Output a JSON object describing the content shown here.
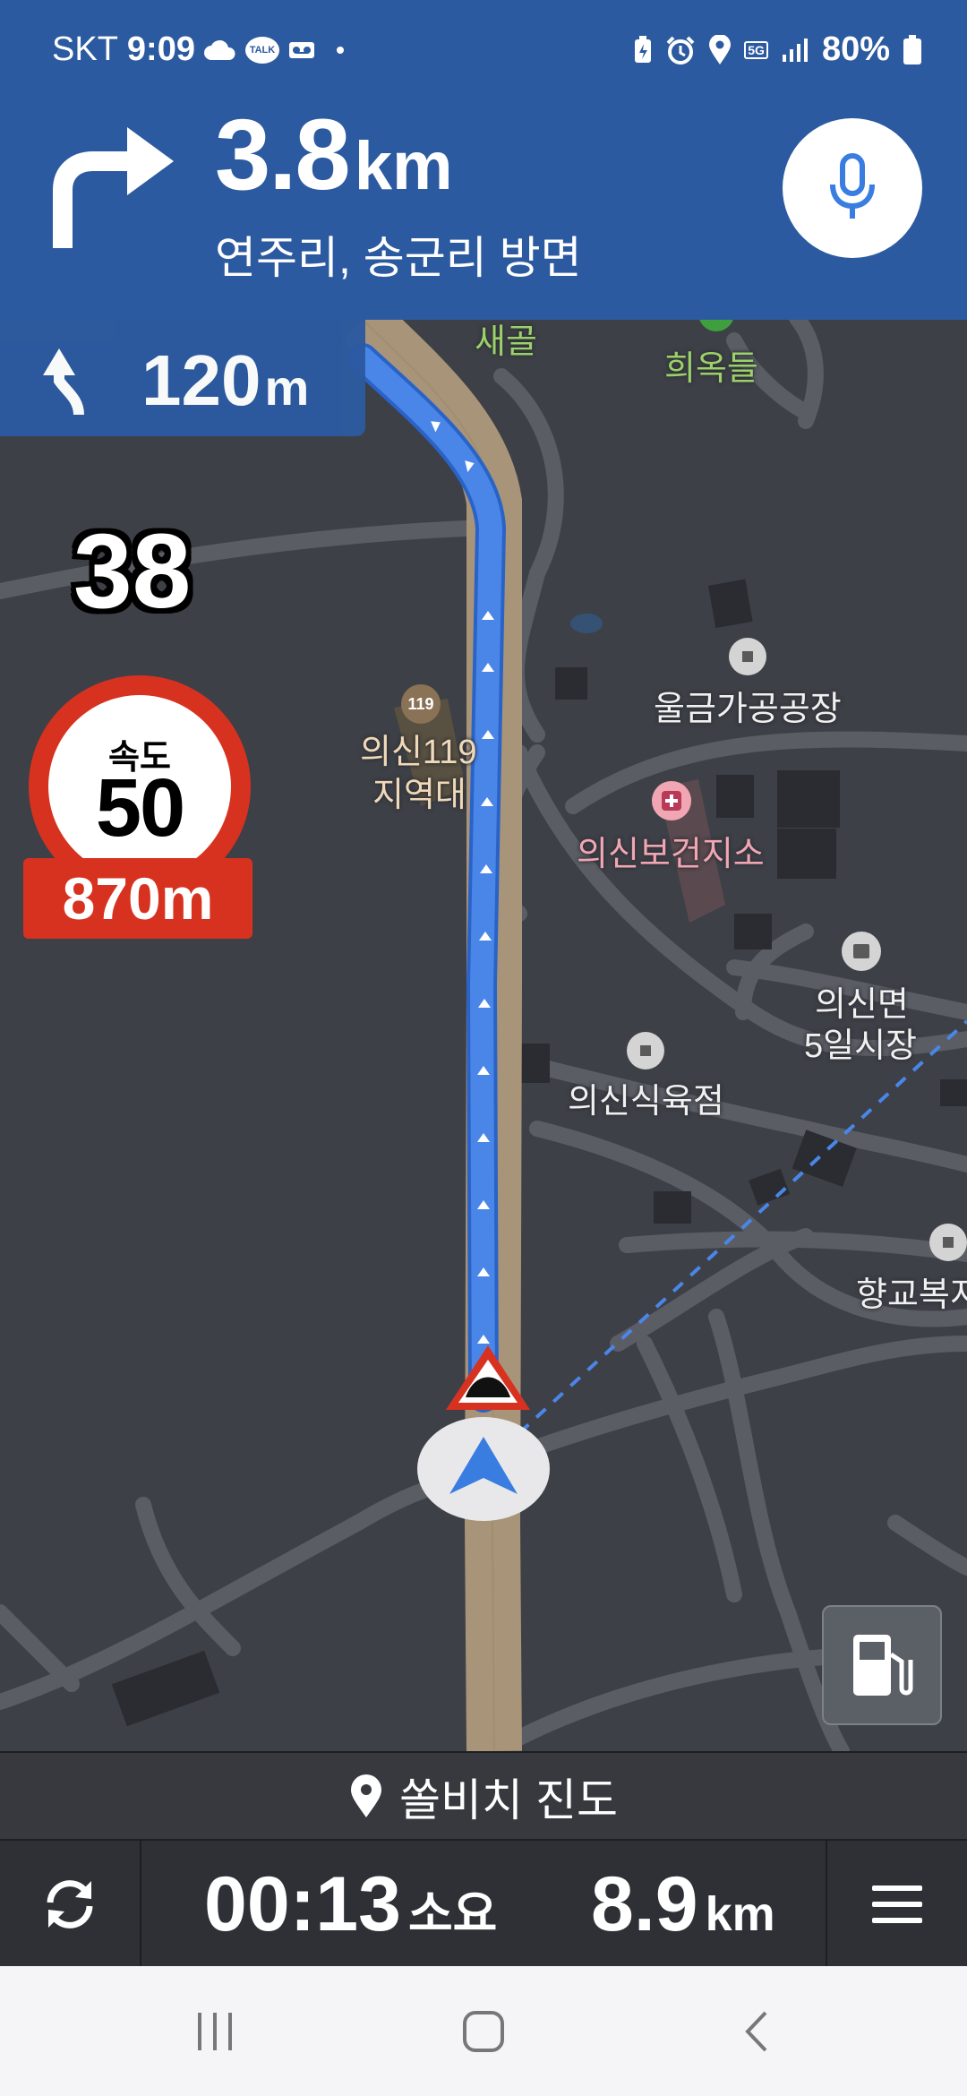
{
  "status_bar": {
    "carrier": "SKT",
    "time": "9:09",
    "network": "5G",
    "battery": "80%",
    "icons": [
      "cloud-icon",
      "kakaotalk-icon",
      "voicemail-icon",
      "dot-icon",
      "battery-saver-icon",
      "alarm-icon",
      "location-icon",
      "signal-icon",
      "battery-icon"
    ]
  },
  "guidance": {
    "distance_value": "3.8",
    "distance_unit": "km",
    "direction_text": "연주리, 송군리 방면",
    "turn_icon": "turn-right-icon",
    "voice_icon": "microphone-icon"
  },
  "next_turn": {
    "distance_value": "120",
    "distance_unit": "m",
    "turn_icon": "turn-left-curve-icon"
  },
  "current_speed": "38",
  "speed_limit": {
    "label": "속도",
    "value": "50",
    "distance": "870m"
  },
  "map_labels": {
    "saegol": "새골",
    "huiokdeul": "희옥들",
    "fire_station_line1": "의신119",
    "fire_station_line2": "지역대",
    "factory": "울금가공공장",
    "health_center": "의신보건지소",
    "market_line1": "의신면",
    "market_line2": "5일시장",
    "butcher": "의신식육점",
    "welfare": "향교복지"
  },
  "destination": {
    "name": "쏠비치 진도",
    "icon": "location-pin-icon"
  },
  "trip": {
    "eta_value": "00:13",
    "eta_unit": "소요",
    "distance_value": "8.9",
    "distance_unit": "km"
  },
  "colors": {
    "header_blue": "#2c5aa0",
    "route_blue": "#4a86e8",
    "speed_red": "#d7321f",
    "map_bg": "#3e4047"
  }
}
